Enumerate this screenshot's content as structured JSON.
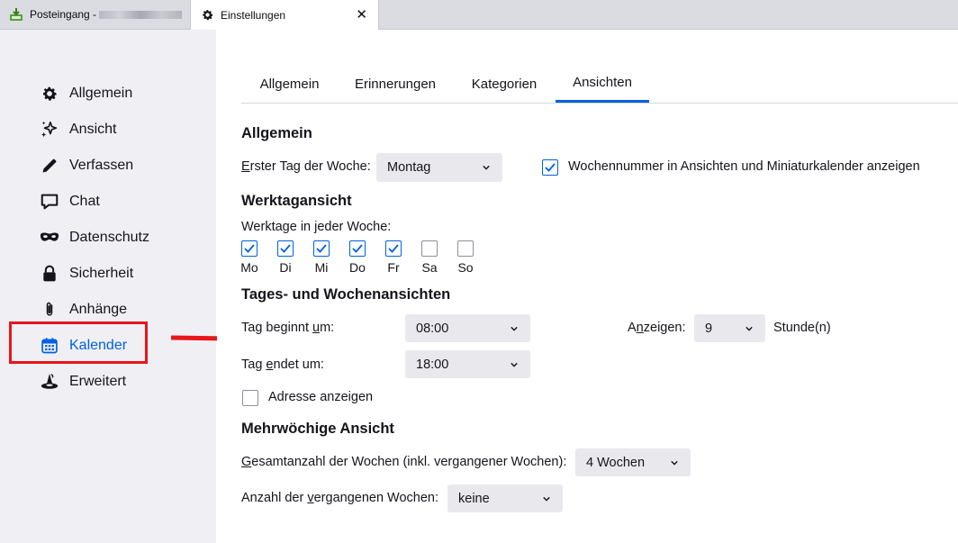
{
  "tabs": {
    "inbox_label": "Posteingang -",
    "settings_label": "Einstellungen"
  },
  "sidebar": {
    "items": [
      {
        "label": "Allgemein",
        "icon": "gear-icon"
      },
      {
        "label": "Ansicht",
        "icon": "sparkle-icon"
      },
      {
        "label": "Verfassen",
        "icon": "pen-icon"
      },
      {
        "label": "Chat",
        "icon": "chat-icon"
      },
      {
        "label": "Datenschutz",
        "icon": "mask-icon"
      },
      {
        "label": "Sicherheit",
        "icon": "lock-icon"
      },
      {
        "label": "Anhänge",
        "icon": "paperclip-icon"
      },
      {
        "label": "Kalender",
        "icon": "calendar-icon",
        "selected": true
      },
      {
        "label": "Erweitert",
        "icon": "wizard-icon"
      }
    ]
  },
  "subtabs": [
    "Allgemein",
    "Erinnerungen",
    "Kategorien",
    "Ansichten"
  ],
  "active_subtab": "Ansichten",
  "general": {
    "heading": "Allgemein",
    "first_day_label": "Erster Tag der Woche:",
    "first_day_value": "Montag",
    "week_number_label": "Wochennummer in Ansichten und Miniaturkalender anzeigen",
    "week_number_checked": true
  },
  "workweek": {
    "heading": "Werktagansicht",
    "days_label": "Werktage in jeder Woche:",
    "days": [
      {
        "label": "Mo",
        "checked": true
      },
      {
        "label": "Di",
        "checked": true
      },
      {
        "label": "Mi",
        "checked": true
      },
      {
        "label": "Do",
        "checked": true
      },
      {
        "label": "Fr",
        "checked": true
      },
      {
        "label": "Sa",
        "checked": false
      },
      {
        "label": "So",
        "checked": false
      }
    ]
  },
  "dayweek": {
    "heading": "Tages- und Wochenansichten",
    "day_start_label": "Tag beginnt um:",
    "day_start_value": "08:00",
    "day_end_label": "Tag endet um:",
    "day_end_value": "18:00",
    "show_label": "Anzeigen:",
    "show_value": "9",
    "hours_label": "Stunde(n)",
    "location_label": "Adresse anzeigen",
    "location_checked": false
  },
  "multiweek": {
    "heading": "Mehrwöchige Ansicht",
    "total_label": "Gesamtanzahl der Wochen (inkl. vergangener Wochen):",
    "total_value": "4 Wochen",
    "past_label": "Anzahl der vergangenen Wochen:",
    "past_value": "keine"
  },
  "colors": {
    "accent": "#0061e0",
    "highlight": "#e8151b"
  }
}
